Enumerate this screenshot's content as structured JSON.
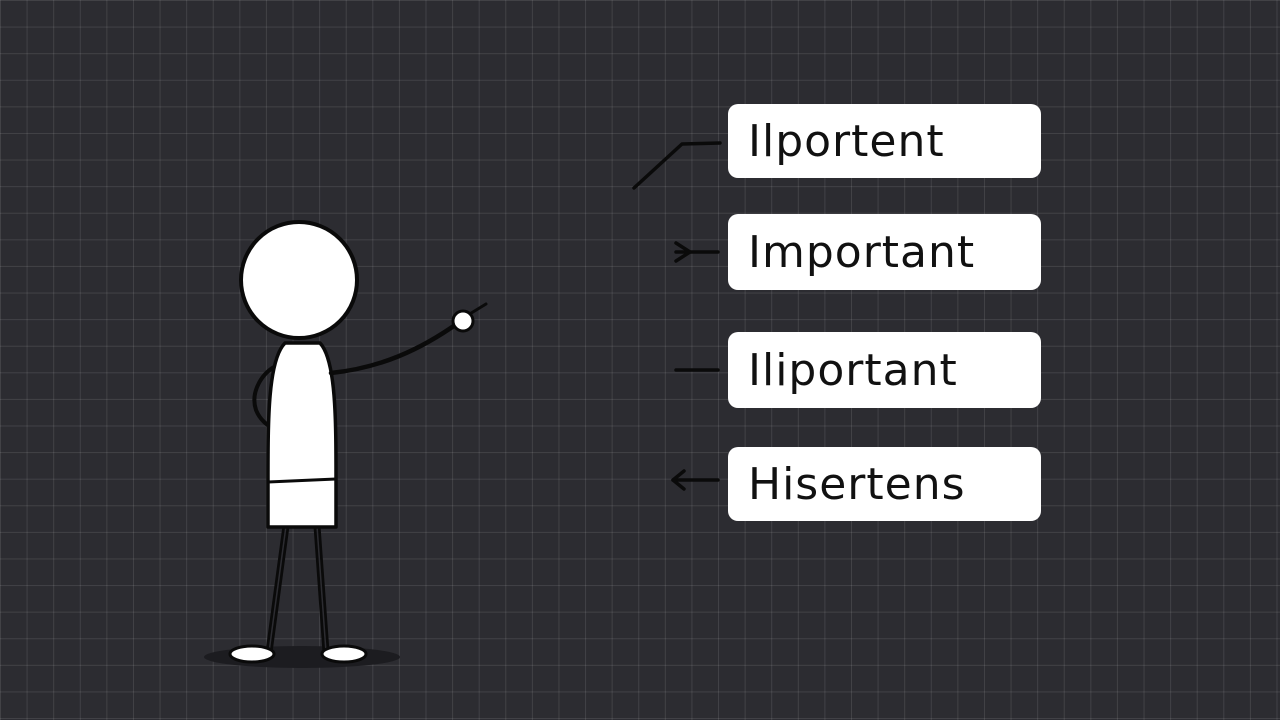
{
  "labels": {
    "items": [
      {
        "text": "Ilportent",
        "connector": "angled-line"
      },
      {
        "text": "Important",
        "connector": "arrow-right"
      },
      {
        "text": "Iliportant",
        "connector": "dash"
      },
      {
        "text": "Hisertens",
        "connector": "arrow-left"
      }
    ]
  },
  "colors": {
    "background": "#2c2c31",
    "card": "#ffffff",
    "ink": "#111111"
  }
}
